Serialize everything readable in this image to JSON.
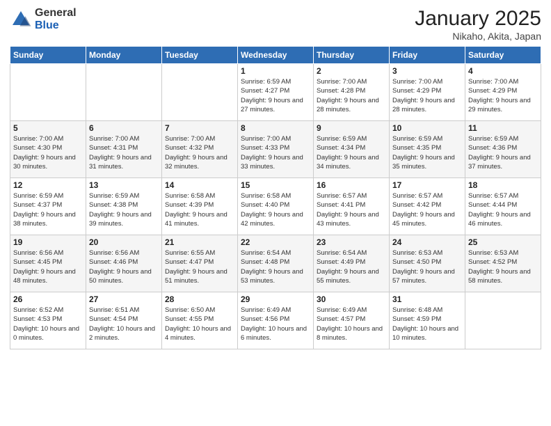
{
  "logo": {
    "general": "General",
    "blue": "Blue"
  },
  "header": {
    "month": "January 2025",
    "location": "Nikaho, Akita, Japan"
  },
  "weekdays": [
    "Sunday",
    "Monday",
    "Tuesday",
    "Wednesday",
    "Thursday",
    "Friday",
    "Saturday"
  ],
  "weeks": [
    [
      {
        "day": "",
        "info": ""
      },
      {
        "day": "",
        "info": ""
      },
      {
        "day": "",
        "info": ""
      },
      {
        "day": "1",
        "info": "Sunrise: 6:59 AM\nSunset: 4:27 PM\nDaylight: 9 hours and 27 minutes."
      },
      {
        "day": "2",
        "info": "Sunrise: 7:00 AM\nSunset: 4:28 PM\nDaylight: 9 hours and 28 minutes."
      },
      {
        "day": "3",
        "info": "Sunrise: 7:00 AM\nSunset: 4:29 PM\nDaylight: 9 hours and 28 minutes."
      },
      {
        "day": "4",
        "info": "Sunrise: 7:00 AM\nSunset: 4:29 PM\nDaylight: 9 hours and 29 minutes."
      }
    ],
    [
      {
        "day": "5",
        "info": "Sunrise: 7:00 AM\nSunset: 4:30 PM\nDaylight: 9 hours and 30 minutes."
      },
      {
        "day": "6",
        "info": "Sunrise: 7:00 AM\nSunset: 4:31 PM\nDaylight: 9 hours and 31 minutes."
      },
      {
        "day": "7",
        "info": "Sunrise: 7:00 AM\nSunset: 4:32 PM\nDaylight: 9 hours and 32 minutes."
      },
      {
        "day": "8",
        "info": "Sunrise: 7:00 AM\nSunset: 4:33 PM\nDaylight: 9 hours and 33 minutes."
      },
      {
        "day": "9",
        "info": "Sunrise: 6:59 AM\nSunset: 4:34 PM\nDaylight: 9 hours and 34 minutes."
      },
      {
        "day": "10",
        "info": "Sunrise: 6:59 AM\nSunset: 4:35 PM\nDaylight: 9 hours and 35 minutes."
      },
      {
        "day": "11",
        "info": "Sunrise: 6:59 AM\nSunset: 4:36 PM\nDaylight: 9 hours and 37 minutes."
      }
    ],
    [
      {
        "day": "12",
        "info": "Sunrise: 6:59 AM\nSunset: 4:37 PM\nDaylight: 9 hours and 38 minutes."
      },
      {
        "day": "13",
        "info": "Sunrise: 6:59 AM\nSunset: 4:38 PM\nDaylight: 9 hours and 39 minutes."
      },
      {
        "day": "14",
        "info": "Sunrise: 6:58 AM\nSunset: 4:39 PM\nDaylight: 9 hours and 41 minutes."
      },
      {
        "day": "15",
        "info": "Sunrise: 6:58 AM\nSunset: 4:40 PM\nDaylight: 9 hours and 42 minutes."
      },
      {
        "day": "16",
        "info": "Sunrise: 6:57 AM\nSunset: 4:41 PM\nDaylight: 9 hours and 43 minutes."
      },
      {
        "day": "17",
        "info": "Sunrise: 6:57 AM\nSunset: 4:42 PM\nDaylight: 9 hours and 45 minutes."
      },
      {
        "day": "18",
        "info": "Sunrise: 6:57 AM\nSunset: 4:44 PM\nDaylight: 9 hours and 46 minutes."
      }
    ],
    [
      {
        "day": "19",
        "info": "Sunrise: 6:56 AM\nSunset: 4:45 PM\nDaylight: 9 hours and 48 minutes."
      },
      {
        "day": "20",
        "info": "Sunrise: 6:56 AM\nSunset: 4:46 PM\nDaylight: 9 hours and 50 minutes."
      },
      {
        "day": "21",
        "info": "Sunrise: 6:55 AM\nSunset: 4:47 PM\nDaylight: 9 hours and 51 minutes."
      },
      {
        "day": "22",
        "info": "Sunrise: 6:54 AM\nSunset: 4:48 PM\nDaylight: 9 hours and 53 minutes."
      },
      {
        "day": "23",
        "info": "Sunrise: 6:54 AM\nSunset: 4:49 PM\nDaylight: 9 hours and 55 minutes."
      },
      {
        "day": "24",
        "info": "Sunrise: 6:53 AM\nSunset: 4:50 PM\nDaylight: 9 hours and 57 minutes."
      },
      {
        "day": "25",
        "info": "Sunrise: 6:53 AM\nSunset: 4:52 PM\nDaylight: 9 hours and 58 minutes."
      }
    ],
    [
      {
        "day": "26",
        "info": "Sunrise: 6:52 AM\nSunset: 4:53 PM\nDaylight: 10 hours and 0 minutes."
      },
      {
        "day": "27",
        "info": "Sunrise: 6:51 AM\nSunset: 4:54 PM\nDaylight: 10 hours and 2 minutes."
      },
      {
        "day": "28",
        "info": "Sunrise: 6:50 AM\nSunset: 4:55 PM\nDaylight: 10 hours and 4 minutes."
      },
      {
        "day": "29",
        "info": "Sunrise: 6:49 AM\nSunset: 4:56 PM\nDaylight: 10 hours and 6 minutes."
      },
      {
        "day": "30",
        "info": "Sunrise: 6:49 AM\nSunset: 4:57 PM\nDaylight: 10 hours and 8 minutes."
      },
      {
        "day": "31",
        "info": "Sunrise: 6:48 AM\nSunset: 4:59 PM\nDaylight: 10 hours and 10 minutes."
      },
      {
        "day": "",
        "info": ""
      }
    ]
  ]
}
